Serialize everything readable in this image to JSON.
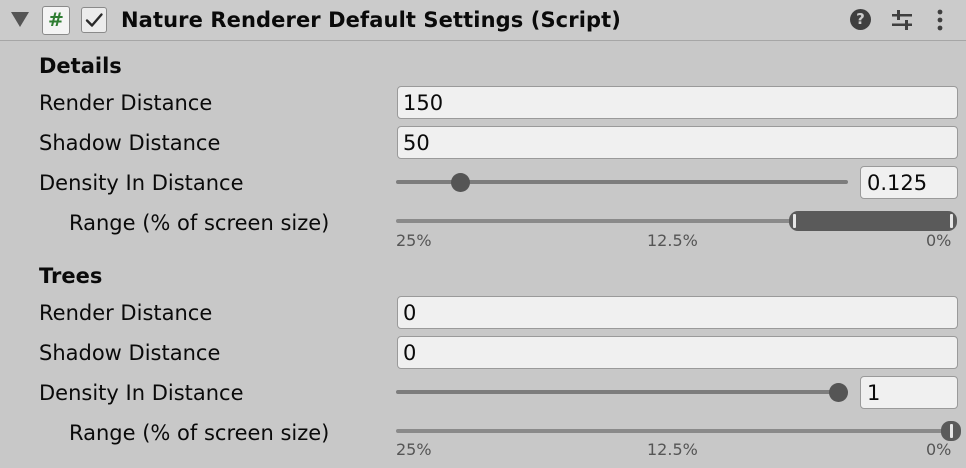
{
  "header": {
    "title": "Nature Renderer Default Settings (Script)",
    "script_icon": "#",
    "enabled": true,
    "help_icon": "?"
  },
  "sections": [
    {
      "title": "Details",
      "render_distance_label": "Render Distance",
      "render_distance": "150",
      "shadow_distance_label": "Shadow Distance",
      "shadow_distance": "50",
      "density_label": "Density In Distance",
      "density": "0.125",
      "density_fraction": 0.125,
      "range_label": "Range (% of screen size)",
      "range_min_percent": 0,
      "range_max_percent": 7.5
    },
    {
      "title": "Trees",
      "render_distance_label": "Render Distance",
      "render_distance": "0",
      "shadow_distance_label": "Shadow Distance",
      "shadow_distance": "0",
      "density_label": "Density In Distance",
      "density": "1",
      "density_fraction": 1,
      "range_label": "Range (% of screen size)",
      "range_min_percent": 0,
      "range_max_percent": 0.5
    }
  ],
  "range_ticks": [
    "25%",
    "12.5%",
    "0%"
  ],
  "colors": {
    "panel": "#c8c8c8",
    "script_icon": "#2f7d32",
    "slider": "#555555"
  }
}
